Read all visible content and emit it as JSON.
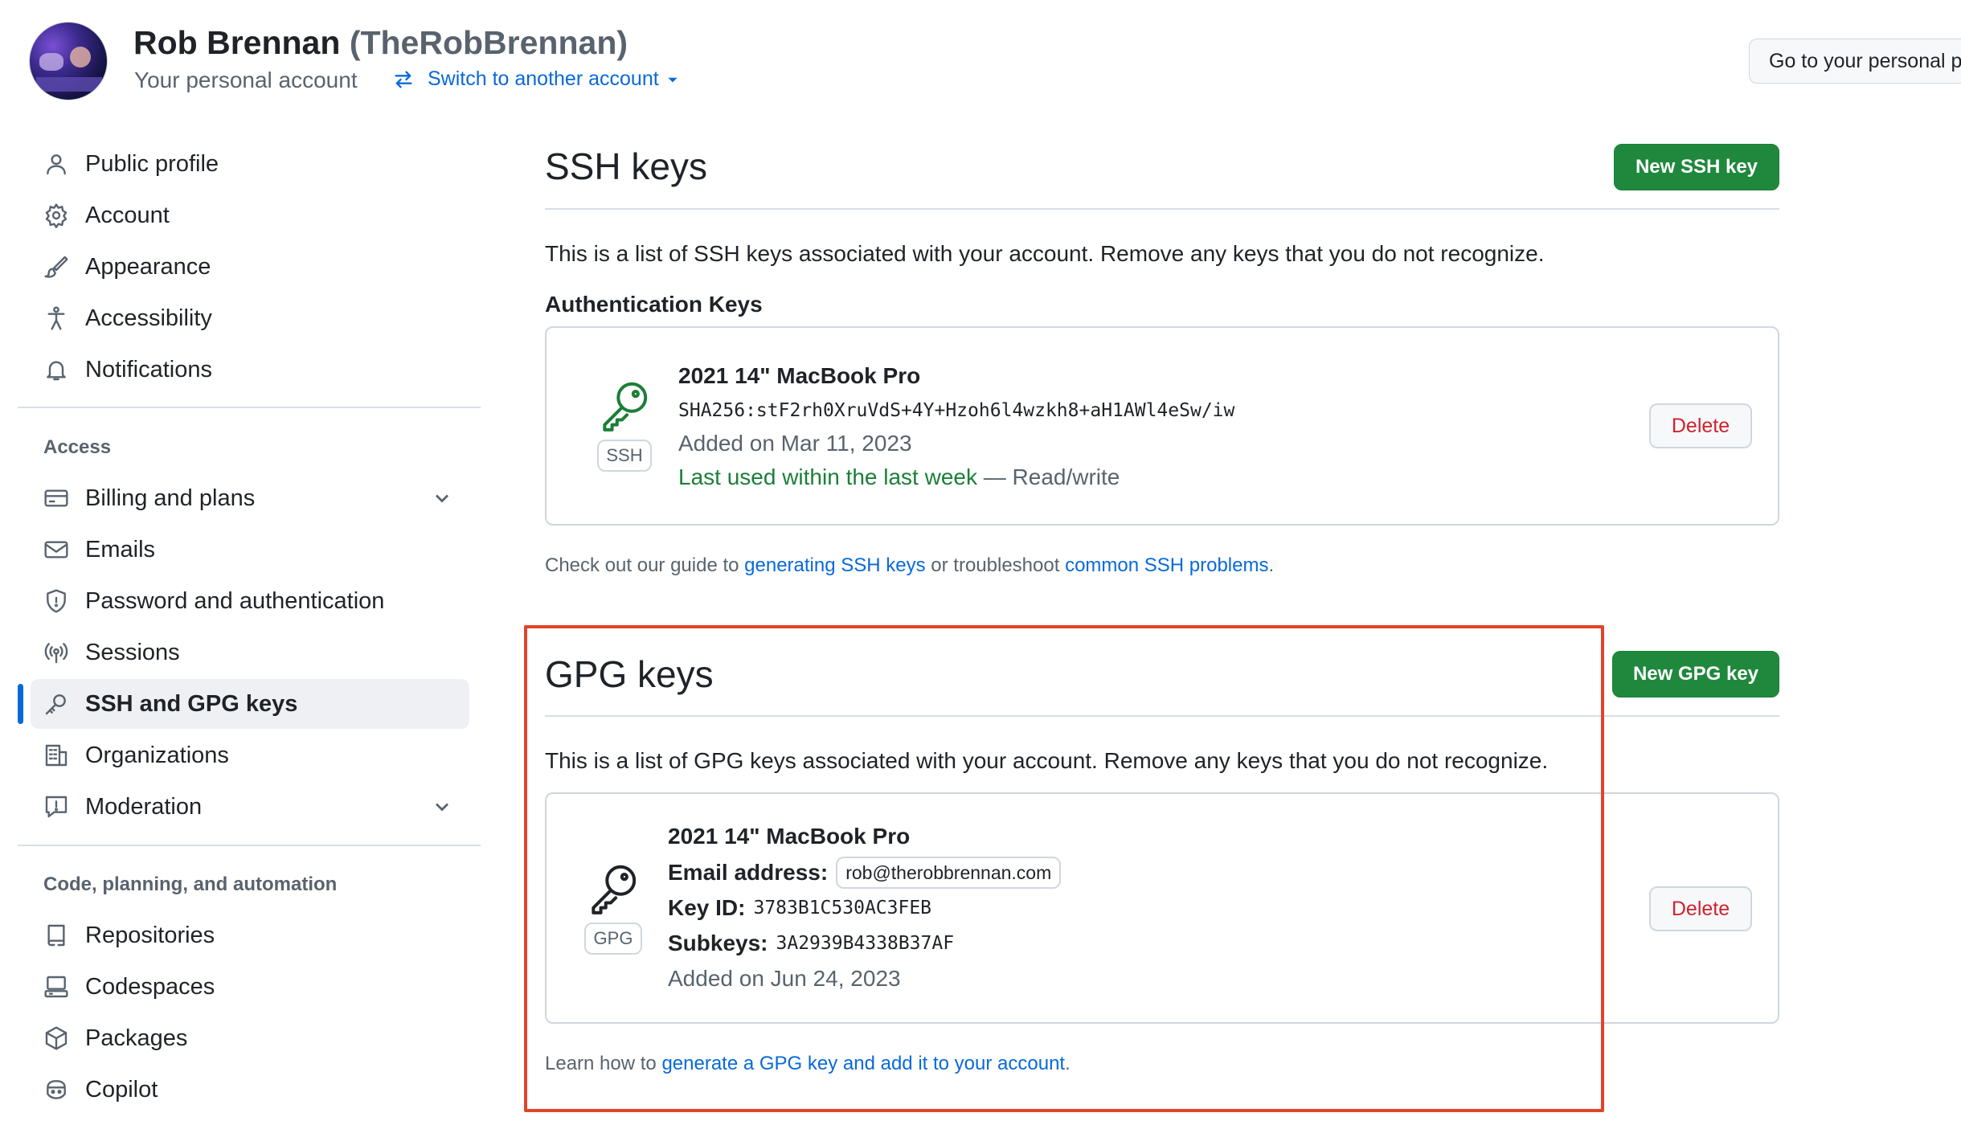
{
  "header": {
    "name": "Rob Brennan",
    "handle": "(TheRobBrennan)",
    "subtitle": "Your personal account",
    "switch_label": "Switch to another account",
    "go_button": "Go to your personal profile"
  },
  "sidebar": {
    "items": [
      {
        "label": "Public profile",
        "icon": "person-icon"
      },
      {
        "label": "Account",
        "icon": "gear-icon"
      },
      {
        "label": "Appearance",
        "icon": "paintbrush-icon"
      },
      {
        "label": "Accessibility",
        "icon": "accessibility-icon"
      },
      {
        "label": "Notifications",
        "icon": "bell-icon"
      }
    ],
    "access_label": "Access",
    "access_items": [
      {
        "label": "Billing and plans",
        "icon": "credit-card-icon",
        "expandable": true
      },
      {
        "label": "Emails",
        "icon": "mail-icon"
      },
      {
        "label": "Password and authentication",
        "icon": "shield-icon"
      },
      {
        "label": "Sessions",
        "icon": "broadcast-icon"
      },
      {
        "label": "SSH and GPG keys",
        "icon": "key-icon",
        "active": true
      },
      {
        "label": "Organizations",
        "icon": "organization-icon"
      },
      {
        "label": "Moderation",
        "icon": "report-icon",
        "expandable": true
      }
    ],
    "code_label": "Code, planning, and automation",
    "code_items": [
      {
        "label": "Repositories",
        "icon": "repo-icon"
      },
      {
        "label": "Codespaces",
        "icon": "codespaces-icon"
      },
      {
        "label": "Packages",
        "icon": "package-icon"
      },
      {
        "label": "Copilot",
        "icon": "copilot-icon"
      }
    ]
  },
  "ssh": {
    "title": "SSH keys",
    "new_button": "New SSH key",
    "description": "This is a list of SSH keys associated with your account. Remove any keys that you do not recognize.",
    "auth_heading": "Authentication Keys",
    "key": {
      "badge": "SSH",
      "title": "2021 14\" MacBook Pro",
      "fingerprint": "SHA256:stF2rh0XruVdS+4Y+Hzoh6l4wzkh8+aH1AWl4eSw/iw",
      "added": "Added on Mar 11, 2023",
      "last_used": "Last used within the last week",
      "access": " — Read/write",
      "delete": "Delete"
    },
    "guide_prefix": "Check out our guide to ",
    "guide_link": "generating SSH keys",
    "guide_middle": " or troubleshoot ",
    "guide_link2": "common SSH problems",
    "guide_suffix": "."
  },
  "gpg": {
    "title": "GPG keys",
    "new_button": "New GPG key",
    "description": "This is a list of GPG keys associated with your account. Remove any keys that you do not recognize.",
    "key": {
      "badge": "GPG",
      "title": "2021 14\" MacBook Pro",
      "email_label": "Email address:",
      "email": "rob@therobbrennan.com",
      "keyid_label": "Key ID:",
      "keyid": "3783B1C530AC3FEB",
      "subkeys_label": "Subkeys:",
      "subkeys": "3A2939B4338B37AF",
      "added": "Added on Jun 24, 2023",
      "delete": "Delete"
    },
    "learn_prefix": "Learn how to ",
    "learn_link": "generate a GPG key and add it to your account",
    "learn_suffix": "."
  },
  "colors": {
    "accent": "#0969da",
    "primary_button": "#1f883d",
    "danger": "#cf222e",
    "success_text": "#1a7f37",
    "highlight_box": "#e1442a"
  }
}
